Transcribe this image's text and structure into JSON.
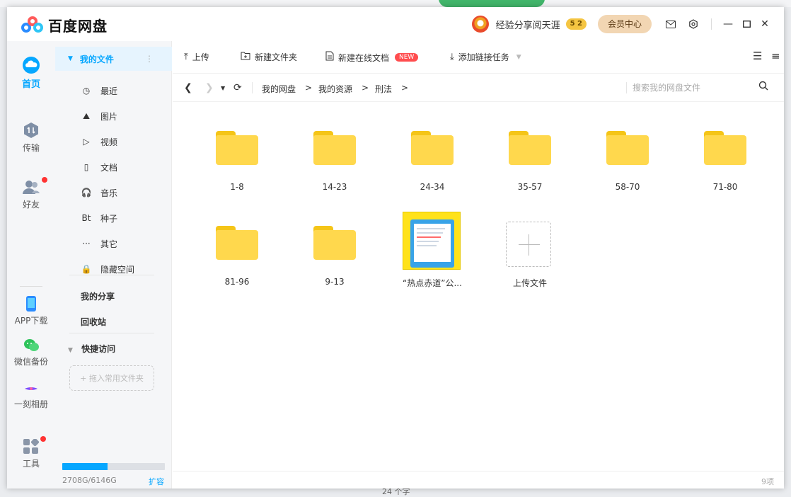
{
  "app": {
    "title": "百度网盘"
  },
  "header": {
    "user_name": "经验分享阅天涯",
    "level_badge": "5 2",
    "vip_button": "会员中心"
  },
  "rail": {
    "home": "首页",
    "transfer": "传输",
    "friends": "好友",
    "app_download": "APP下载",
    "wechat_backup": "微信备份",
    "moment_album": "一刻相册",
    "tools": "工具"
  },
  "sidenav": {
    "my_files": "我的文件",
    "items": [
      {
        "icon": "◷",
        "label": "最近"
      },
      {
        "icon": "⛰",
        "label": "图片"
      },
      {
        "icon": "▷",
        "label": "视频"
      },
      {
        "icon": "▯",
        "label": "文档"
      },
      {
        "icon": "🎧",
        "label": "音乐"
      },
      {
        "icon": "Bt",
        "label": "种子"
      },
      {
        "icon": "···",
        "label": "其它"
      },
      {
        "icon": "🔒",
        "label": "隐藏空间"
      }
    ],
    "my_share": "我的分享",
    "recycle_bin": "回收站",
    "quick_access": "快捷访问",
    "quick_access_placeholder": "+ 拖入常用文件夹",
    "quota_text": "2708G/6146G",
    "quota_fraction": 0.4406,
    "expand_label": "扩容"
  },
  "toolbar": {
    "upload": "上传",
    "new_folder": "新建文件夹",
    "new_doc": "新建在线文档",
    "new_badge": "NEW",
    "add_link_task": "添加链接任务"
  },
  "path": {
    "crumbs": [
      "我的网盘",
      "我的资源",
      "刑法"
    ],
    "separator": ">",
    "search_placeholder": "搜索我的网盘文件"
  },
  "files": [
    {
      "type": "folder",
      "name": "1-8"
    },
    {
      "type": "folder",
      "name": "14-23"
    },
    {
      "type": "folder",
      "name": "24-34"
    },
    {
      "type": "folder",
      "name": "35-57"
    },
    {
      "type": "folder",
      "name": "58-70"
    },
    {
      "type": "folder",
      "name": "71-80"
    },
    {
      "type": "folder",
      "name": "81-96"
    },
    {
      "type": "folder",
      "name": "9-13"
    },
    {
      "type": "image",
      "name": "“热点赤道”公..."
    },
    {
      "type": "upload",
      "name": "上传文件"
    }
  ],
  "status": {
    "count_text": "9项"
  },
  "background": {
    "bottom_text": "24 个字"
  },
  "colors": {
    "accent": "#06a7ff",
    "folder": "#ffd84d",
    "badge_red": "#ff4d4f"
  }
}
